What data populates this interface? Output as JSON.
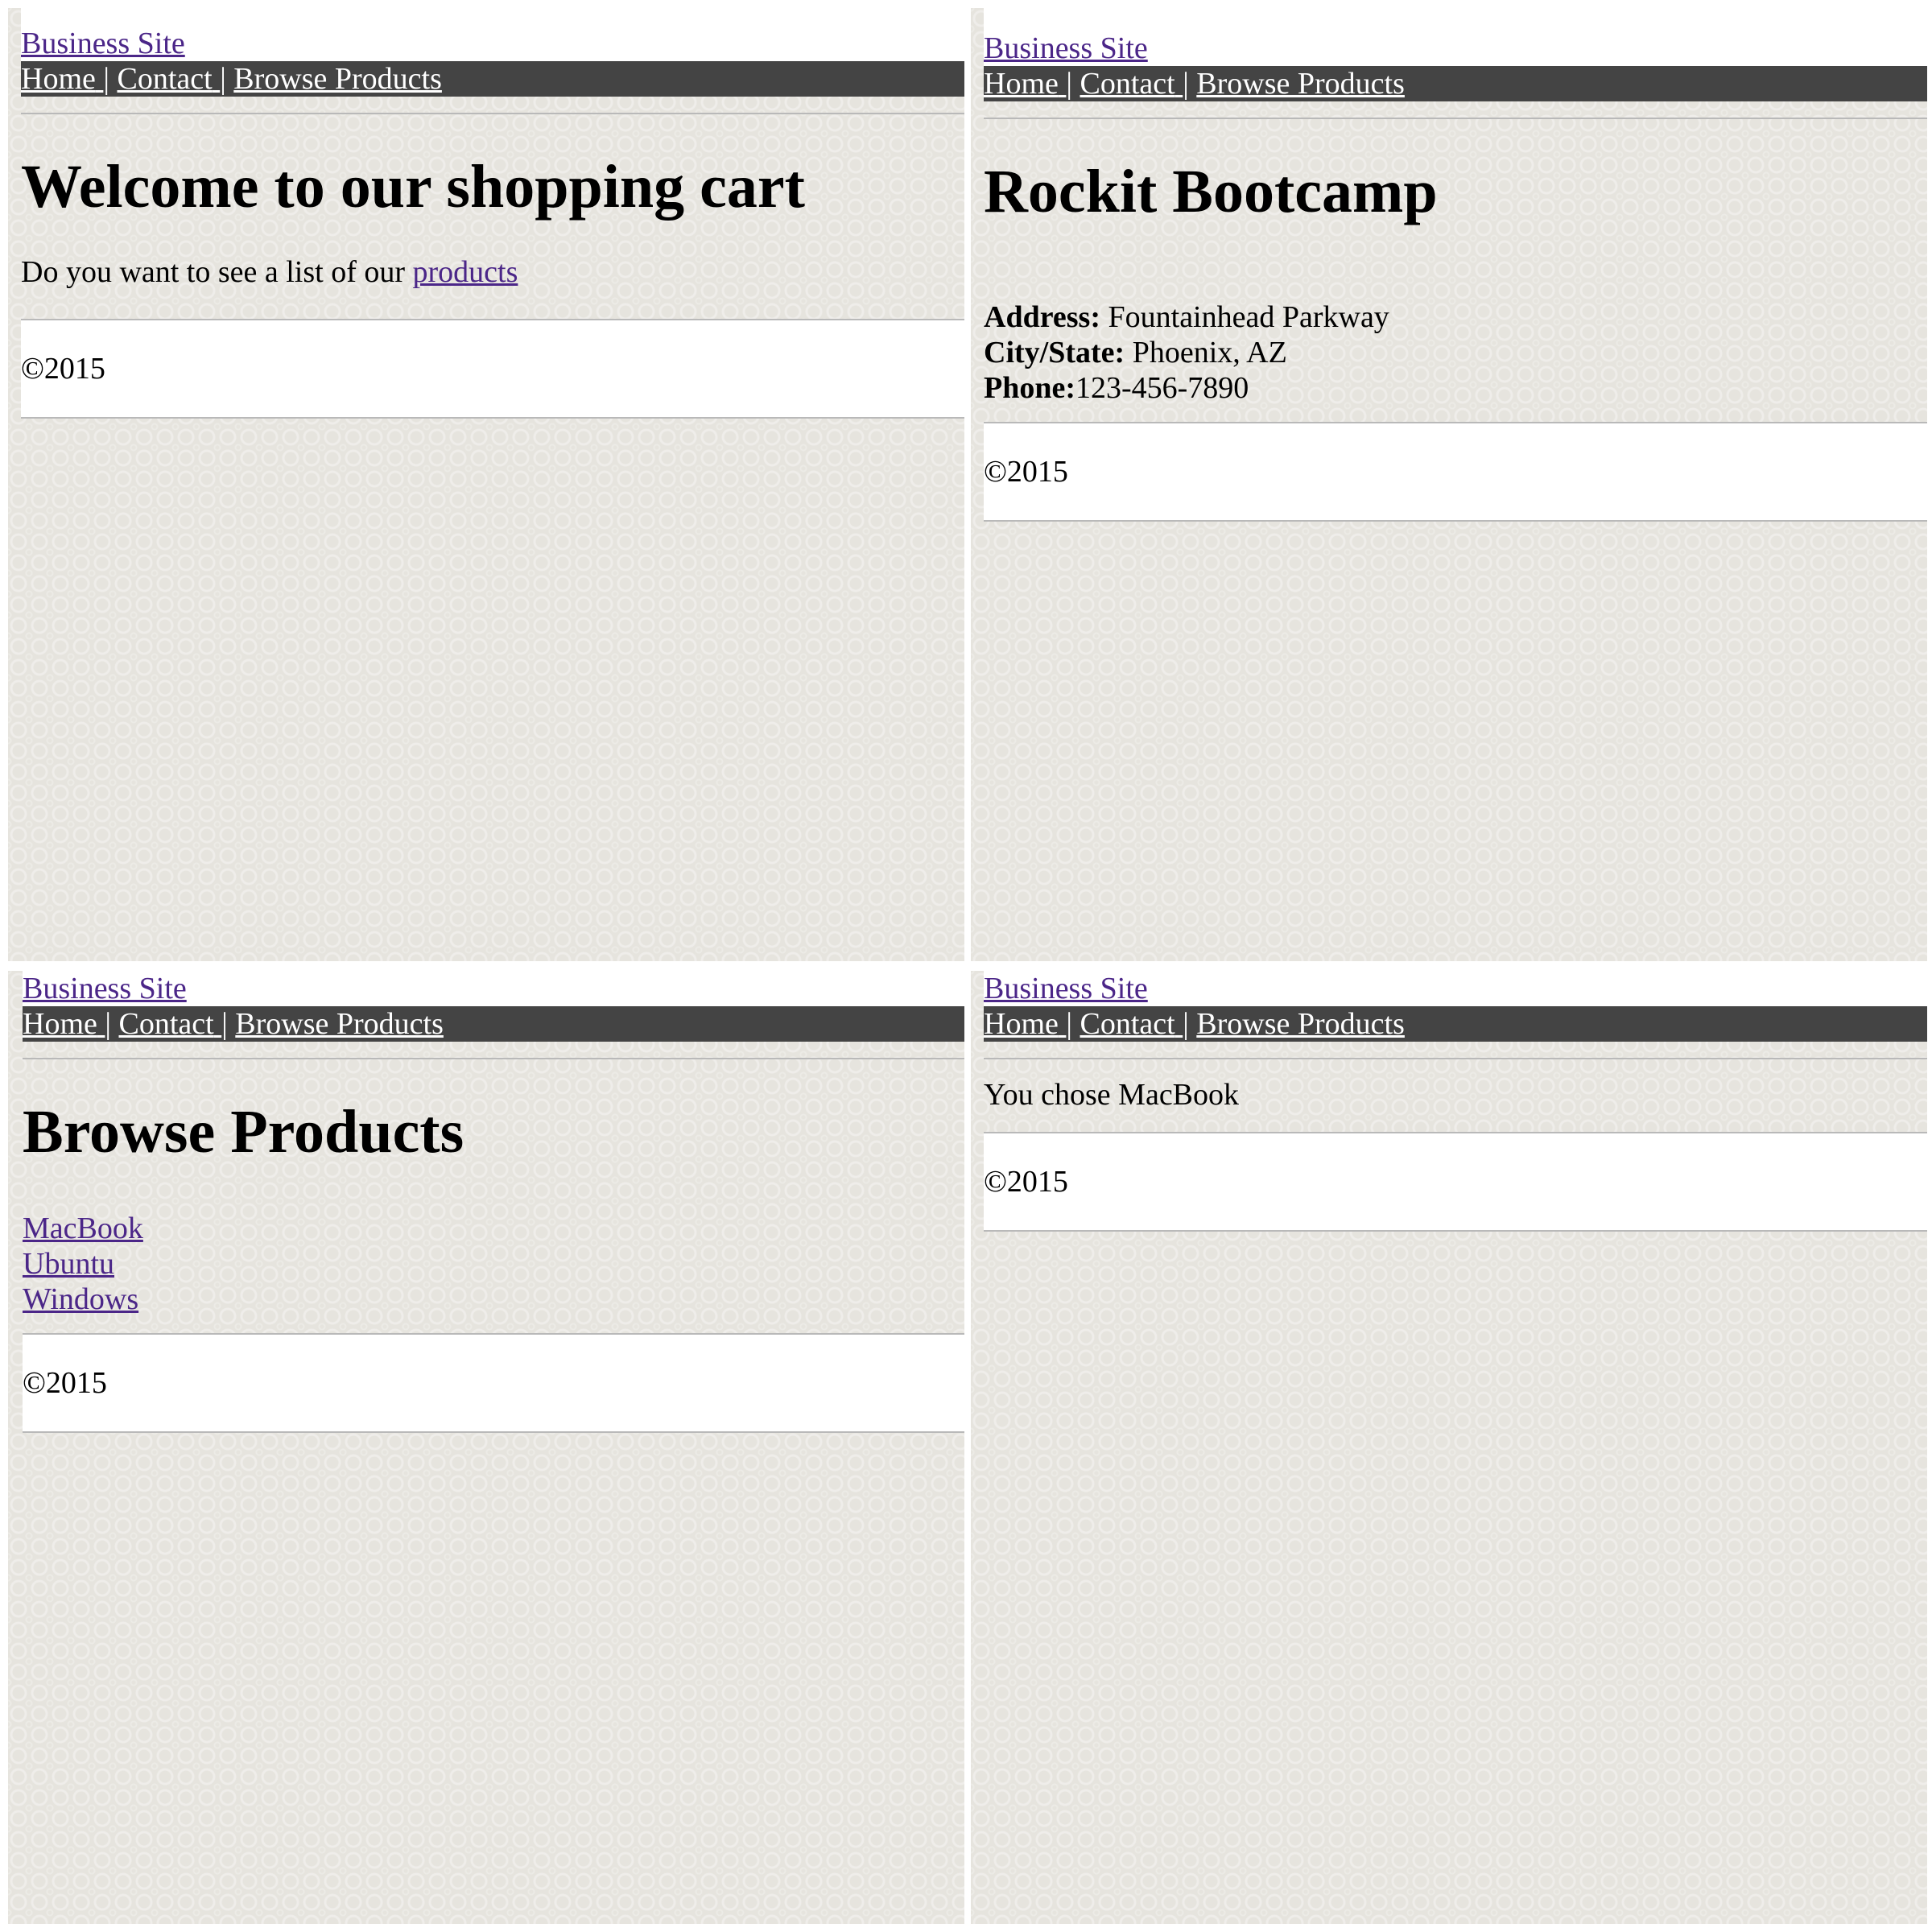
{
  "site": {
    "name": "Business Site",
    "nav": {
      "home": "Home",
      "contact": "Contact",
      "browse": "Browse Products",
      "separator": "|"
    },
    "footer": "©2015",
    "link_color": "#4b2688",
    "nav_background": "#444444"
  },
  "home_page": {
    "heading": "Welcome to our shopping cart",
    "intro_text": "Do you want to see a list of our",
    "intro_link": "products"
  },
  "contact_page": {
    "heading": "Rockit Bootcamp",
    "address_label": "Address:",
    "address_value": "Fountainhead Parkway",
    "city_label": "City/State:",
    "city_value": "Phoenix, AZ",
    "phone_label": "Phone:",
    "phone_value": "123-456-7890"
  },
  "browse_page": {
    "heading": "Browse Products",
    "products": [
      "MacBook",
      "Ubuntu",
      "Windows"
    ]
  },
  "choice_page": {
    "message": "You chose MacBook"
  }
}
